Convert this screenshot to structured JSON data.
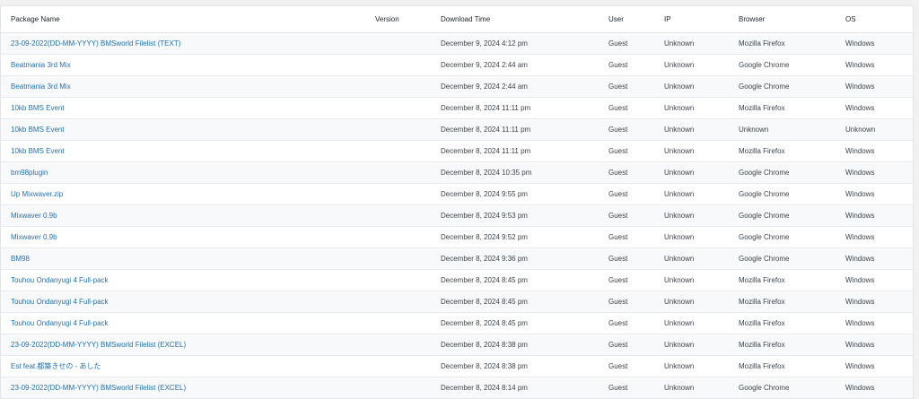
{
  "columns": {
    "package": "Package Name",
    "version": "Version",
    "time": "Download Time",
    "user": "User",
    "ip": "IP",
    "browser": "Browser",
    "os": "OS"
  },
  "colors": {
    "link": "#2271b1",
    "header_text": "#1d2327",
    "row_alt": "#f8f9fa",
    "border": "#e2e4e7"
  },
  "rows": [
    {
      "package": "23-09-2022(DD-MM-YYYY) BMSworld Filelist (TEXT)",
      "version": "",
      "time": "December 9, 2024 4:12 pm",
      "user": "Guest",
      "ip": "Unknown",
      "browser": "Mozilla Firefox",
      "os": "Windows"
    },
    {
      "package": "Beatmania 3rd Mix",
      "version": "",
      "time": "December 9, 2024 2:44 am",
      "user": "Guest",
      "ip": "Unknown",
      "browser": "Google Chrome",
      "os": "Windows"
    },
    {
      "package": "Beatmania 3rd Mix",
      "version": "",
      "time": "December 9, 2024 2:44 am",
      "user": "Guest",
      "ip": "Unknown",
      "browser": "Google Chrome",
      "os": "Windows"
    },
    {
      "package": "10kb BMS Event",
      "version": "",
      "time": "December 8, 2024 11:11 pm",
      "user": "Guest",
      "ip": "Unknown",
      "browser": "Mozilla Firefox",
      "os": "Windows"
    },
    {
      "package": "10kb BMS Event",
      "version": "",
      "time": "December 8, 2024 11:11 pm",
      "user": "Guest",
      "ip": "Unknown",
      "browser": "Unknown",
      "os": "Unknown"
    },
    {
      "package": "10kb BMS Event",
      "version": "",
      "time": "December 8, 2024 11:11 pm",
      "user": "Guest",
      "ip": "Unknown",
      "browser": "Mozilla Firefox",
      "os": "Windows"
    },
    {
      "package": "bm98plugin",
      "version": "",
      "time": "December 8, 2024 10:35 pm",
      "user": "Guest",
      "ip": "Unknown",
      "browser": "Google Chrome",
      "os": "Windows"
    },
    {
      "package": "Up Mixwaver.zip",
      "version": "",
      "time": "December 8, 2024 9:55 pm",
      "user": "Guest",
      "ip": "Unknown",
      "browser": "Google Chrome",
      "os": "Windows"
    },
    {
      "package": "Mixwaver 0.9b",
      "version": "",
      "time": "December 8, 2024 9:53 pm",
      "user": "Guest",
      "ip": "Unknown",
      "browser": "Google Chrome",
      "os": "Windows"
    },
    {
      "package": "Mixwaver 0.9b",
      "version": "",
      "time": "December 8, 2024 9:52 pm",
      "user": "Guest",
      "ip": "Unknown",
      "browser": "Google Chrome",
      "os": "Windows"
    },
    {
      "package": "BM98",
      "version": "",
      "time": "December 8, 2024 9:36 pm",
      "user": "Guest",
      "ip": "Unknown",
      "browser": "Google Chrome",
      "os": "Windows"
    },
    {
      "package": "Touhou Ondanyugi 4 Full-pack",
      "version": "",
      "time": "December 8, 2024 8:45 pm",
      "user": "Guest",
      "ip": "Unknown",
      "browser": "Mozilla Firefox",
      "os": "Windows"
    },
    {
      "package": "Touhou Ondanyugi 4 Full-pack",
      "version": "",
      "time": "December 8, 2024 8:45 pm",
      "user": "Guest",
      "ip": "Unknown",
      "browser": "Mozilla Firefox",
      "os": "Windows"
    },
    {
      "package": "Touhou Ondanyugi 4 Full-pack",
      "version": "",
      "time": "December 8, 2024 8:45 pm",
      "user": "Guest",
      "ip": "Unknown",
      "browser": "Mozilla Firefox",
      "os": "Windows"
    },
    {
      "package": "23-09-2022(DD-MM-YYYY) BMSworld Filelist (EXCEL)",
      "version": "",
      "time": "December 8, 2024 8:38 pm",
      "user": "Guest",
      "ip": "Unknown",
      "browser": "Mozilla Firefox",
      "os": "Windows"
    },
    {
      "package": "Est feat.都築きせの - あした",
      "version": "",
      "time": "December 8, 2024 8:38 pm",
      "user": "Guest",
      "ip": "Unknown",
      "browser": "Mozilla Firefox",
      "os": "Windows"
    },
    {
      "package": "23-09-2022(DD-MM-YYYY) BMSworld Filelist (EXCEL)",
      "version": "",
      "time": "December 8, 2024 8:14 pm",
      "user": "Guest",
      "ip": "Unknown",
      "browser": "Google Chrome",
      "os": "Windows"
    }
  ]
}
